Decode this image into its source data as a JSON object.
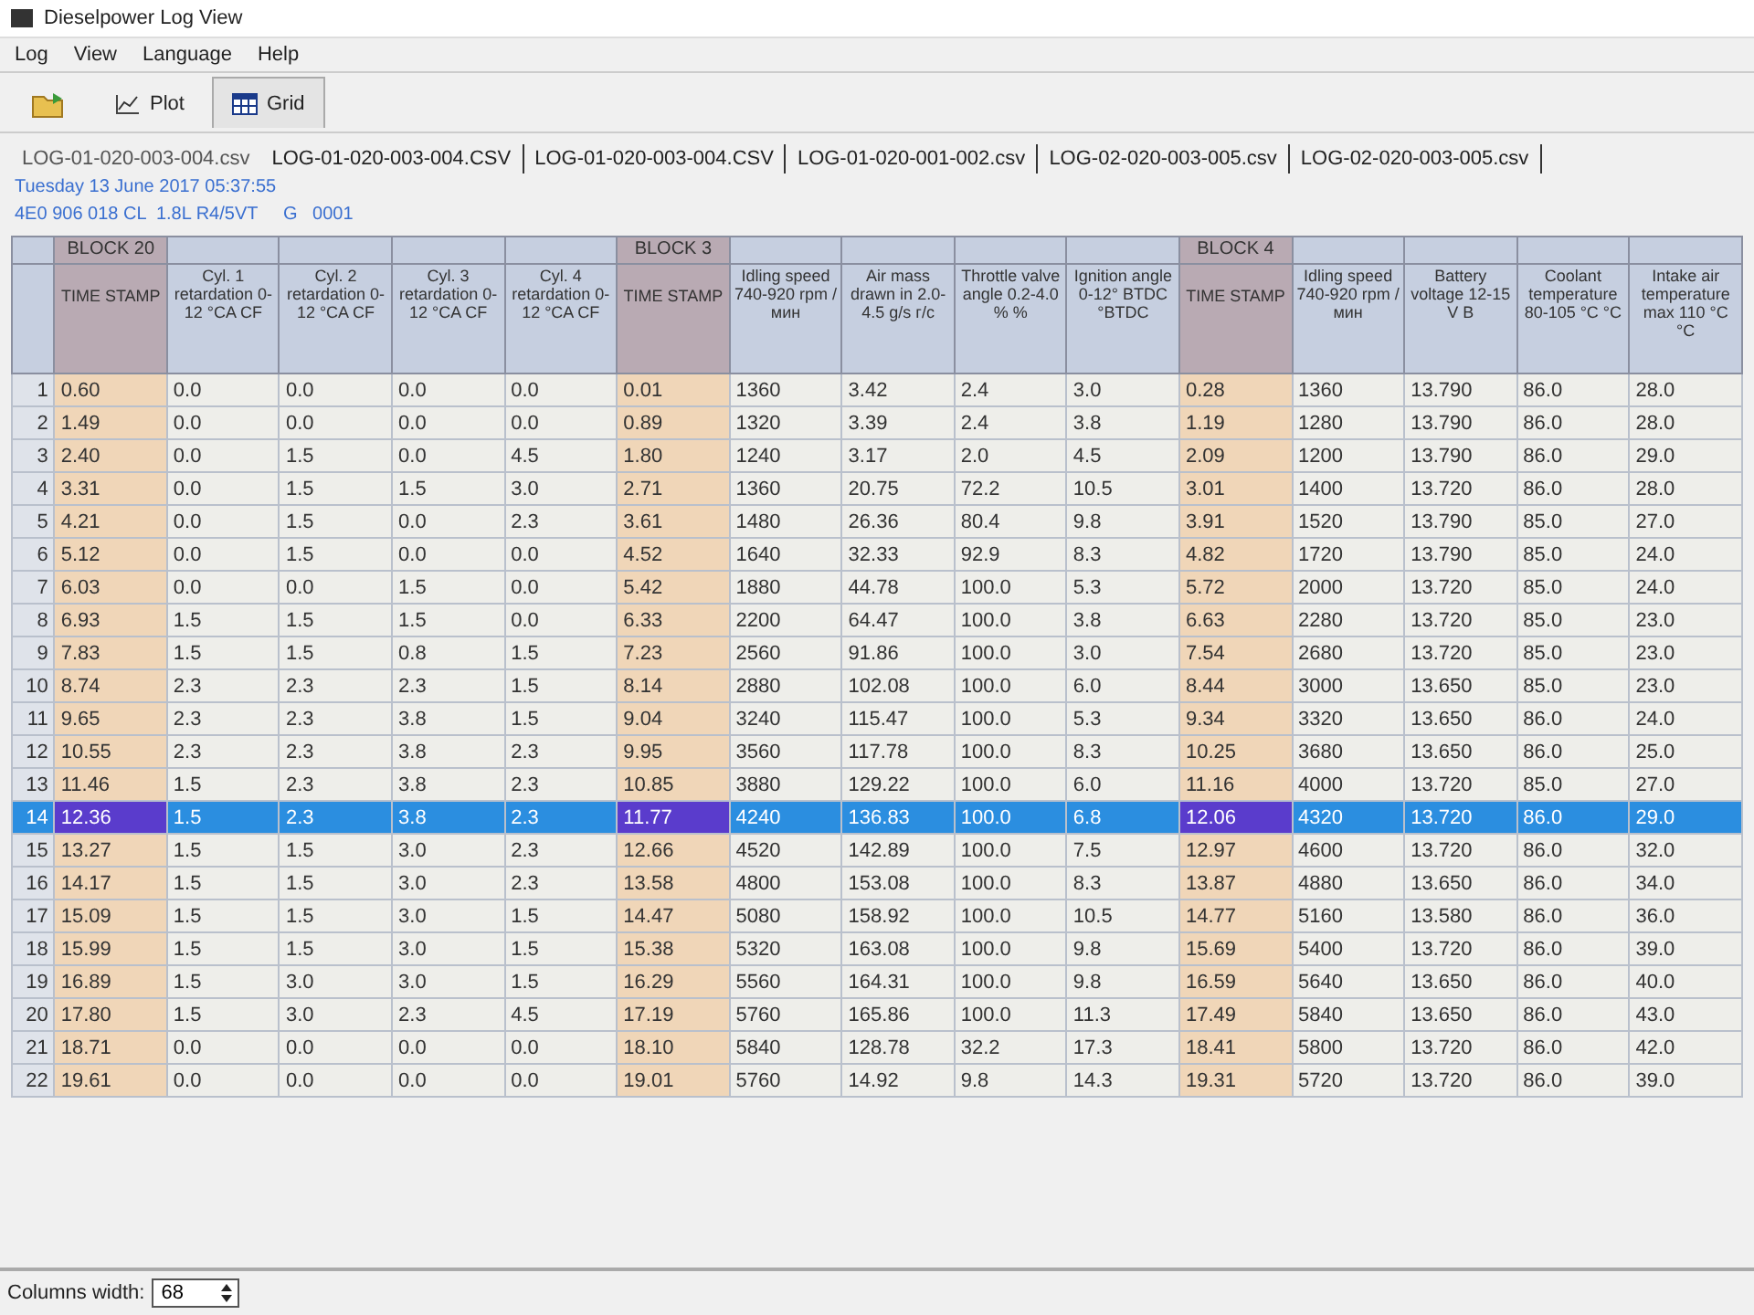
{
  "window": {
    "title": "Dieselpower Log View"
  },
  "menu": [
    "Log",
    "View",
    "Language",
    "Help"
  ],
  "toolbar": [
    {
      "kind": "open",
      "selected": false
    },
    {
      "kind": "plot",
      "label": "Plot",
      "selected": false
    },
    {
      "kind": "grid",
      "label": "Grid",
      "selected": true
    }
  ],
  "file_tabs": [
    {
      "label": "LOG-01-020-003-004.csv",
      "selected": true
    },
    {
      "label": "LOG-01-020-003-004.CSV",
      "selected": false
    },
    {
      "label": "LOG-01-020-003-004.CSV",
      "selected": false
    },
    {
      "label": "LOG-01-020-001-002.csv",
      "selected": false
    },
    {
      "label": "LOG-02-020-003-005.csv",
      "selected": false
    },
    {
      "label": "LOG-02-020-003-005.csv",
      "selected": false
    }
  ],
  "info": [
    "Tuesday 13 June 2017 05:37:55",
    "4E0 906 018 CL  1.8L R4/5VT     G   0001"
  ],
  "table": {
    "columns": [
      {
        "kind": "index"
      },
      {
        "kind": "timestamp",
        "block": "BLOCK 20",
        "label": "TIME STAMP"
      },
      {
        "kind": "value",
        "label": "Cyl. 1 retardation 0-12 °CA CF"
      },
      {
        "kind": "value",
        "label": "Cyl. 2 retardation 0-12 °CA CF"
      },
      {
        "kind": "value",
        "label": "Cyl. 3 retardation 0-12 °CA CF"
      },
      {
        "kind": "value",
        "label": "Cyl. 4 retardation 0-12 °CA CF"
      },
      {
        "kind": "timestamp",
        "block": "BLOCK 3",
        "label": "TIME STAMP"
      },
      {
        "kind": "value",
        "label": "Idling speed 740-920 rpm /мин"
      },
      {
        "kind": "value",
        "label": "Air mass drawn in 2.0-4.5 g/s г/с"
      },
      {
        "kind": "value",
        "label": "Throttle valve angle 0.2-4.0 % %"
      },
      {
        "kind": "value",
        "label": "Ignition angle 0-12° BTDC °BTDC"
      },
      {
        "kind": "timestamp",
        "block": "BLOCK 4",
        "label": "TIME STAMP"
      },
      {
        "kind": "value",
        "label": "Idling speed 740-920 rpm /мин"
      },
      {
        "kind": "value",
        "label": "Battery voltage 12-15 V В"
      },
      {
        "kind": "value",
        "label": "Coolant temperature 80-105 °C °C"
      },
      {
        "kind": "value",
        "label": "Intake air temperature max 110 °C °C"
      }
    ],
    "rows": [
      {
        "selected": false,
        "cells": [
          "1",
          "0.60",
          "0.0",
          "0.0",
          "0.0",
          "0.0",
          "0.01",
          "1360",
          "3.42",
          "2.4",
          "3.0",
          "0.28",
          "1360",
          "13.790",
          "86.0",
          "28.0"
        ]
      },
      {
        "selected": false,
        "cells": [
          "2",
          "1.49",
          "0.0",
          "0.0",
          "0.0",
          "0.0",
          "0.89",
          "1320",
          "3.39",
          "2.4",
          "3.8",
          "1.19",
          "1280",
          "13.790",
          "86.0",
          "28.0"
        ]
      },
      {
        "selected": false,
        "cells": [
          "3",
          "2.40",
          "0.0",
          "1.5",
          "0.0",
          "4.5",
          "1.80",
          "1240",
          "3.17",
          "2.0",
          "4.5",
          "2.09",
          "1200",
          "13.790",
          "86.0",
          "29.0"
        ]
      },
      {
        "selected": false,
        "cells": [
          "4",
          "3.31",
          "0.0",
          "1.5",
          "1.5",
          "3.0",
          "2.71",
          "1360",
          "20.75",
          "72.2",
          "10.5",
          "3.01",
          "1400",
          "13.720",
          "86.0",
          "28.0"
        ]
      },
      {
        "selected": false,
        "cells": [
          "5",
          "4.21",
          "0.0",
          "1.5",
          "0.0",
          "2.3",
          "3.61",
          "1480",
          "26.36",
          "80.4",
          "9.8",
          "3.91",
          "1520",
          "13.790",
          "85.0",
          "27.0"
        ]
      },
      {
        "selected": false,
        "cells": [
          "6",
          "5.12",
          "0.0",
          "1.5",
          "0.0",
          "0.0",
          "4.52",
          "1640",
          "32.33",
          "92.9",
          "8.3",
          "4.82",
          "1720",
          "13.790",
          "85.0",
          "24.0"
        ]
      },
      {
        "selected": false,
        "cells": [
          "7",
          "6.03",
          "0.0",
          "0.0",
          "1.5",
          "0.0",
          "5.42",
          "1880",
          "44.78",
          "100.0",
          "5.3",
          "5.72",
          "2000",
          "13.720",
          "85.0",
          "24.0"
        ]
      },
      {
        "selected": false,
        "cells": [
          "8",
          "6.93",
          "1.5",
          "1.5",
          "1.5",
          "0.0",
          "6.33",
          "2200",
          "64.47",
          "100.0",
          "3.8",
          "6.63",
          "2280",
          "13.720",
          "85.0",
          "23.0"
        ]
      },
      {
        "selected": false,
        "cells": [
          "9",
          "7.83",
          "1.5",
          "1.5",
          "0.8",
          "1.5",
          "7.23",
          "2560",
          "91.86",
          "100.0",
          "3.0",
          "7.54",
          "2680",
          "13.720",
          "85.0",
          "23.0"
        ]
      },
      {
        "selected": false,
        "cells": [
          "10",
          "8.74",
          "2.3",
          "2.3",
          "2.3",
          "1.5",
          "8.14",
          "2880",
          "102.08",
          "100.0",
          "6.0",
          "8.44",
          "3000",
          "13.650",
          "85.0",
          "23.0"
        ]
      },
      {
        "selected": false,
        "cells": [
          "11",
          "9.65",
          "2.3",
          "2.3",
          "3.8",
          "1.5",
          "9.04",
          "3240",
          "115.47",
          "100.0",
          "5.3",
          "9.34",
          "3320",
          "13.650",
          "86.0",
          "24.0"
        ]
      },
      {
        "selected": false,
        "cells": [
          "12",
          "10.55",
          "2.3",
          "2.3",
          "3.8",
          "2.3",
          "9.95",
          "3560",
          "117.78",
          "100.0",
          "8.3",
          "10.25",
          "3680",
          "13.650",
          "86.0",
          "25.0"
        ]
      },
      {
        "selected": false,
        "cells": [
          "13",
          "11.46",
          "1.5",
          "2.3",
          "3.8",
          "2.3",
          "10.85",
          "3880",
          "129.22",
          "100.0",
          "6.0",
          "11.16",
          "4000",
          "13.720",
          "85.0",
          "27.0"
        ]
      },
      {
        "selected": true,
        "cells": [
          "14",
          "12.36",
          "1.5",
          "2.3",
          "3.8",
          "2.3",
          "11.77",
          "4240",
          "136.83",
          "100.0",
          "6.8",
          "12.06",
          "4320",
          "13.720",
          "86.0",
          "29.0"
        ]
      },
      {
        "selected": false,
        "cells": [
          "15",
          "13.27",
          "1.5",
          "1.5",
          "3.0",
          "2.3",
          "12.66",
          "4520",
          "142.89",
          "100.0",
          "7.5",
          "12.97",
          "4600",
          "13.720",
          "86.0",
          "32.0"
        ]
      },
      {
        "selected": false,
        "cells": [
          "16",
          "14.17",
          "1.5",
          "1.5",
          "3.0",
          "2.3",
          "13.58",
          "4800",
          "153.08",
          "100.0",
          "8.3",
          "13.87",
          "4880",
          "13.650",
          "86.0",
          "34.0"
        ]
      },
      {
        "selected": false,
        "cells": [
          "17",
          "15.09",
          "1.5",
          "1.5",
          "3.0",
          "1.5",
          "14.47",
          "5080",
          "158.92",
          "100.0",
          "10.5",
          "14.77",
          "5160",
          "13.580",
          "86.0",
          "36.0"
        ]
      },
      {
        "selected": false,
        "cells": [
          "18",
          "15.99",
          "1.5",
          "1.5",
          "3.0",
          "1.5",
          "15.38",
          "5320",
          "163.08",
          "100.0",
          "9.8",
          "15.69",
          "5400",
          "13.720",
          "86.0",
          "39.0"
        ]
      },
      {
        "selected": false,
        "cells": [
          "19",
          "16.89",
          "1.5",
          "3.0",
          "3.0",
          "1.5",
          "16.29",
          "5560",
          "164.31",
          "100.0",
          "9.8",
          "16.59",
          "5640",
          "13.650",
          "86.0",
          "40.0"
        ]
      },
      {
        "selected": false,
        "cells": [
          "20",
          "17.80",
          "1.5",
          "3.0",
          "2.3",
          "4.5",
          "17.19",
          "5760",
          "165.86",
          "100.0",
          "11.3",
          "17.49",
          "5840",
          "13.650",
          "86.0",
          "43.0"
        ]
      },
      {
        "selected": false,
        "cells": [
          "21",
          "18.71",
          "0.0",
          "0.0",
          "0.0",
          "0.0",
          "18.10",
          "5840",
          "128.78",
          "32.2",
          "17.3",
          "18.41",
          "5800",
          "13.720",
          "86.0",
          "42.0"
        ]
      },
      {
        "selected": false,
        "cells": [
          "22",
          "19.61",
          "0.0",
          "0.0",
          "0.0",
          "0.0",
          "19.01",
          "5760",
          "14.92",
          "9.8",
          "14.3",
          "19.31",
          "5720",
          "13.720",
          "86.0",
          "39.0"
        ]
      }
    ]
  },
  "footer": {
    "label": "Columns width:",
    "value": "68"
  }
}
